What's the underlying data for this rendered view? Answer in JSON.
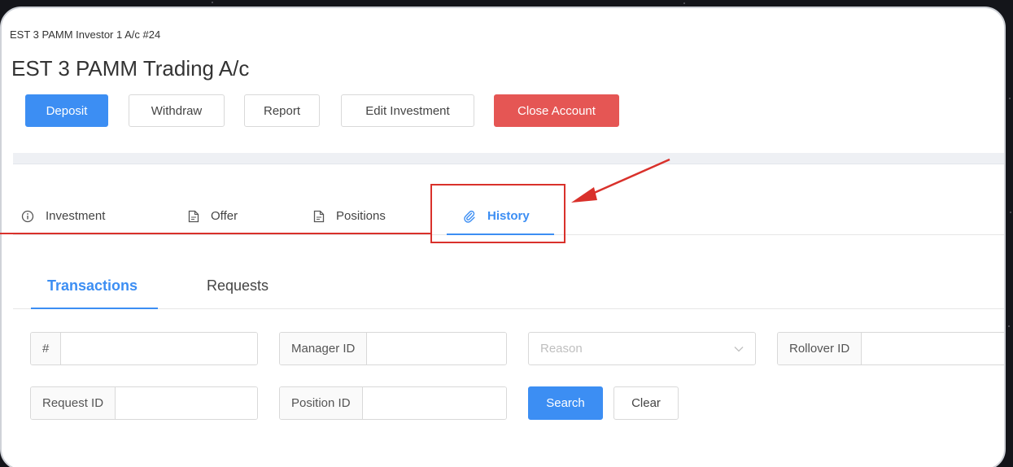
{
  "page": {
    "breadcrumb": "EST 3 PAMM Investor 1 A/c #24",
    "title": "EST 3 PAMM Trading A/c"
  },
  "actions": {
    "deposit": "Deposit",
    "withdraw": "Withdraw",
    "report": "Report",
    "edit_investment": "Edit Investment",
    "close_account": "Close Account"
  },
  "tabs": [
    {
      "label": "Investment",
      "icon": "info-circle-icon"
    },
    {
      "label": "Offer",
      "icon": "document-icon"
    },
    {
      "label": "Positions",
      "icon": "document-icon"
    },
    {
      "label": "History",
      "icon": "paperclip-icon",
      "active": true
    }
  ],
  "subtabs": [
    {
      "label": "Transactions",
      "active": true
    },
    {
      "label": "Requests"
    }
  ],
  "filters": {
    "id_label": "#",
    "id_value": "",
    "manager_id_label": "Manager ID",
    "manager_id_value": "",
    "reason_placeholder": "Reason",
    "rollover_id_label": "Rollover ID",
    "rollover_id_value": "",
    "request_id_label": "Request ID",
    "request_id_value": "",
    "position_id_label": "Position ID",
    "position_id_value": "",
    "search": "Search",
    "clear": "Clear"
  },
  "colors": {
    "primary": "#3c8ef3",
    "danger": "#e55654",
    "annotation": "#d9312b"
  }
}
